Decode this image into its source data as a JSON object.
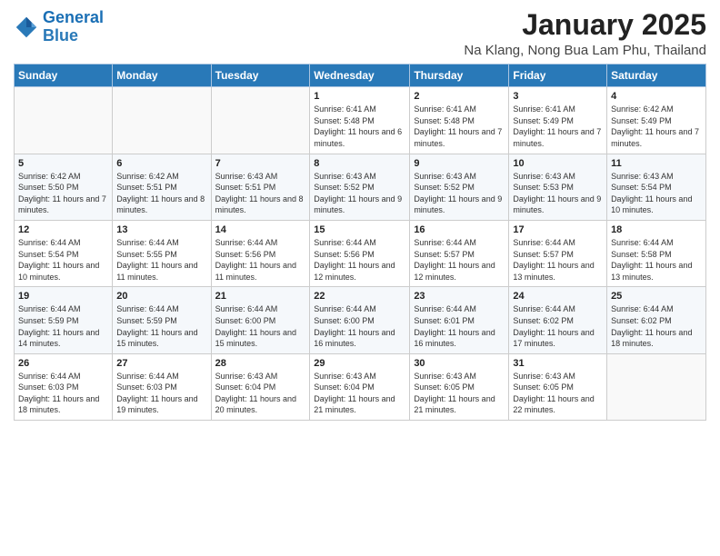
{
  "logo": {
    "line1": "General",
    "line2": "Blue"
  },
  "title": "January 2025",
  "subtitle": "Na Klang, Nong Bua Lam Phu, Thailand",
  "days_of_week": [
    "Sunday",
    "Monday",
    "Tuesday",
    "Wednesday",
    "Thursday",
    "Friday",
    "Saturday"
  ],
  "weeks": [
    [
      {
        "num": "",
        "info": ""
      },
      {
        "num": "",
        "info": ""
      },
      {
        "num": "",
        "info": ""
      },
      {
        "num": "1",
        "info": "Sunrise: 6:41 AM\nSunset: 5:48 PM\nDaylight: 11 hours and 6 minutes."
      },
      {
        "num": "2",
        "info": "Sunrise: 6:41 AM\nSunset: 5:48 PM\nDaylight: 11 hours and 7 minutes."
      },
      {
        "num": "3",
        "info": "Sunrise: 6:41 AM\nSunset: 5:49 PM\nDaylight: 11 hours and 7 minutes."
      },
      {
        "num": "4",
        "info": "Sunrise: 6:42 AM\nSunset: 5:49 PM\nDaylight: 11 hours and 7 minutes."
      }
    ],
    [
      {
        "num": "5",
        "info": "Sunrise: 6:42 AM\nSunset: 5:50 PM\nDaylight: 11 hours and 7 minutes."
      },
      {
        "num": "6",
        "info": "Sunrise: 6:42 AM\nSunset: 5:51 PM\nDaylight: 11 hours and 8 minutes."
      },
      {
        "num": "7",
        "info": "Sunrise: 6:43 AM\nSunset: 5:51 PM\nDaylight: 11 hours and 8 minutes."
      },
      {
        "num": "8",
        "info": "Sunrise: 6:43 AM\nSunset: 5:52 PM\nDaylight: 11 hours and 9 minutes."
      },
      {
        "num": "9",
        "info": "Sunrise: 6:43 AM\nSunset: 5:52 PM\nDaylight: 11 hours and 9 minutes."
      },
      {
        "num": "10",
        "info": "Sunrise: 6:43 AM\nSunset: 5:53 PM\nDaylight: 11 hours and 9 minutes."
      },
      {
        "num": "11",
        "info": "Sunrise: 6:43 AM\nSunset: 5:54 PM\nDaylight: 11 hours and 10 minutes."
      }
    ],
    [
      {
        "num": "12",
        "info": "Sunrise: 6:44 AM\nSunset: 5:54 PM\nDaylight: 11 hours and 10 minutes."
      },
      {
        "num": "13",
        "info": "Sunrise: 6:44 AM\nSunset: 5:55 PM\nDaylight: 11 hours and 11 minutes."
      },
      {
        "num": "14",
        "info": "Sunrise: 6:44 AM\nSunset: 5:56 PM\nDaylight: 11 hours and 11 minutes."
      },
      {
        "num": "15",
        "info": "Sunrise: 6:44 AM\nSunset: 5:56 PM\nDaylight: 11 hours and 12 minutes."
      },
      {
        "num": "16",
        "info": "Sunrise: 6:44 AM\nSunset: 5:57 PM\nDaylight: 11 hours and 12 minutes."
      },
      {
        "num": "17",
        "info": "Sunrise: 6:44 AM\nSunset: 5:57 PM\nDaylight: 11 hours and 13 minutes."
      },
      {
        "num": "18",
        "info": "Sunrise: 6:44 AM\nSunset: 5:58 PM\nDaylight: 11 hours and 13 minutes."
      }
    ],
    [
      {
        "num": "19",
        "info": "Sunrise: 6:44 AM\nSunset: 5:59 PM\nDaylight: 11 hours and 14 minutes."
      },
      {
        "num": "20",
        "info": "Sunrise: 6:44 AM\nSunset: 5:59 PM\nDaylight: 11 hours and 15 minutes."
      },
      {
        "num": "21",
        "info": "Sunrise: 6:44 AM\nSunset: 6:00 PM\nDaylight: 11 hours and 15 minutes."
      },
      {
        "num": "22",
        "info": "Sunrise: 6:44 AM\nSunset: 6:00 PM\nDaylight: 11 hours and 16 minutes."
      },
      {
        "num": "23",
        "info": "Sunrise: 6:44 AM\nSunset: 6:01 PM\nDaylight: 11 hours and 16 minutes."
      },
      {
        "num": "24",
        "info": "Sunrise: 6:44 AM\nSunset: 6:02 PM\nDaylight: 11 hours and 17 minutes."
      },
      {
        "num": "25",
        "info": "Sunrise: 6:44 AM\nSunset: 6:02 PM\nDaylight: 11 hours and 18 minutes."
      }
    ],
    [
      {
        "num": "26",
        "info": "Sunrise: 6:44 AM\nSunset: 6:03 PM\nDaylight: 11 hours and 18 minutes."
      },
      {
        "num": "27",
        "info": "Sunrise: 6:44 AM\nSunset: 6:03 PM\nDaylight: 11 hours and 19 minutes."
      },
      {
        "num": "28",
        "info": "Sunrise: 6:43 AM\nSunset: 6:04 PM\nDaylight: 11 hours and 20 minutes."
      },
      {
        "num": "29",
        "info": "Sunrise: 6:43 AM\nSunset: 6:04 PM\nDaylight: 11 hours and 21 minutes."
      },
      {
        "num": "30",
        "info": "Sunrise: 6:43 AM\nSunset: 6:05 PM\nDaylight: 11 hours and 21 minutes."
      },
      {
        "num": "31",
        "info": "Sunrise: 6:43 AM\nSunset: 6:05 PM\nDaylight: 11 hours and 22 minutes."
      },
      {
        "num": "",
        "info": ""
      }
    ]
  ]
}
